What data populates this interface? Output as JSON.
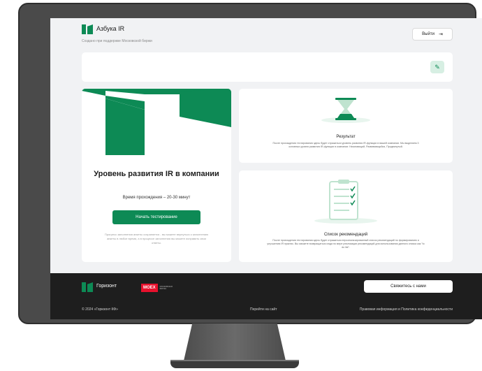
{
  "header": {
    "logo_text": "Азбука IR",
    "subtitle": "Создано при поддержке Московской биржи",
    "exit_label": "Выйти"
  },
  "level_card": {
    "title": "Уровень развития IR в компании",
    "time": "Время прохождения – 20-30 минут",
    "start_label": "Начать тестирование",
    "note": "Прогресс заполнения анкеты сохраняется - вы можете вернуться к заполнению анкеты в любое время, а в процессе заполнения вы можете исправить свои ответы."
  },
  "result_card": {
    "title": "Результат",
    "text": "После прохождения тестирования здесь будет отражаться уровень развития IR-функции в вашей компании. Мы выделяем 3 основных уровня развития IR-функции в компании: Начинающий, Развивающийся, Продвинутый."
  },
  "recs_card": {
    "title": "Список рекомендаций",
    "text": "После прохождения тестирования здесь будет отражаться персонализированный список рекомендаций по формированию и улучшению IR практик. Вы сможете возвращаться сюда по мере реализации рекомендаций для использования данного списка как \"to do list\"."
  },
  "footer": {
    "logo_text": "Горизонт",
    "moex_label": "MOEX",
    "moex_sub": "МОСКОВСКАЯ БИРЖА",
    "contact_label": "Свяжитесь с нами",
    "copyright": "© 2024 «Горизонт КФ»",
    "site_link": "Перейти на сайт",
    "legal_link": "Правовая информация и Политика конфиденциальности"
  },
  "colors": {
    "accent": "#0d8a55",
    "accent_light": "#d7efe3",
    "footer_bg": "#1e1e1e",
    "moex_red": "#e8112d"
  },
  "icons": {
    "exit": "exit-icon",
    "edit": "pencil-icon",
    "result": "hourglass-icon",
    "recs": "checklist-icon"
  }
}
